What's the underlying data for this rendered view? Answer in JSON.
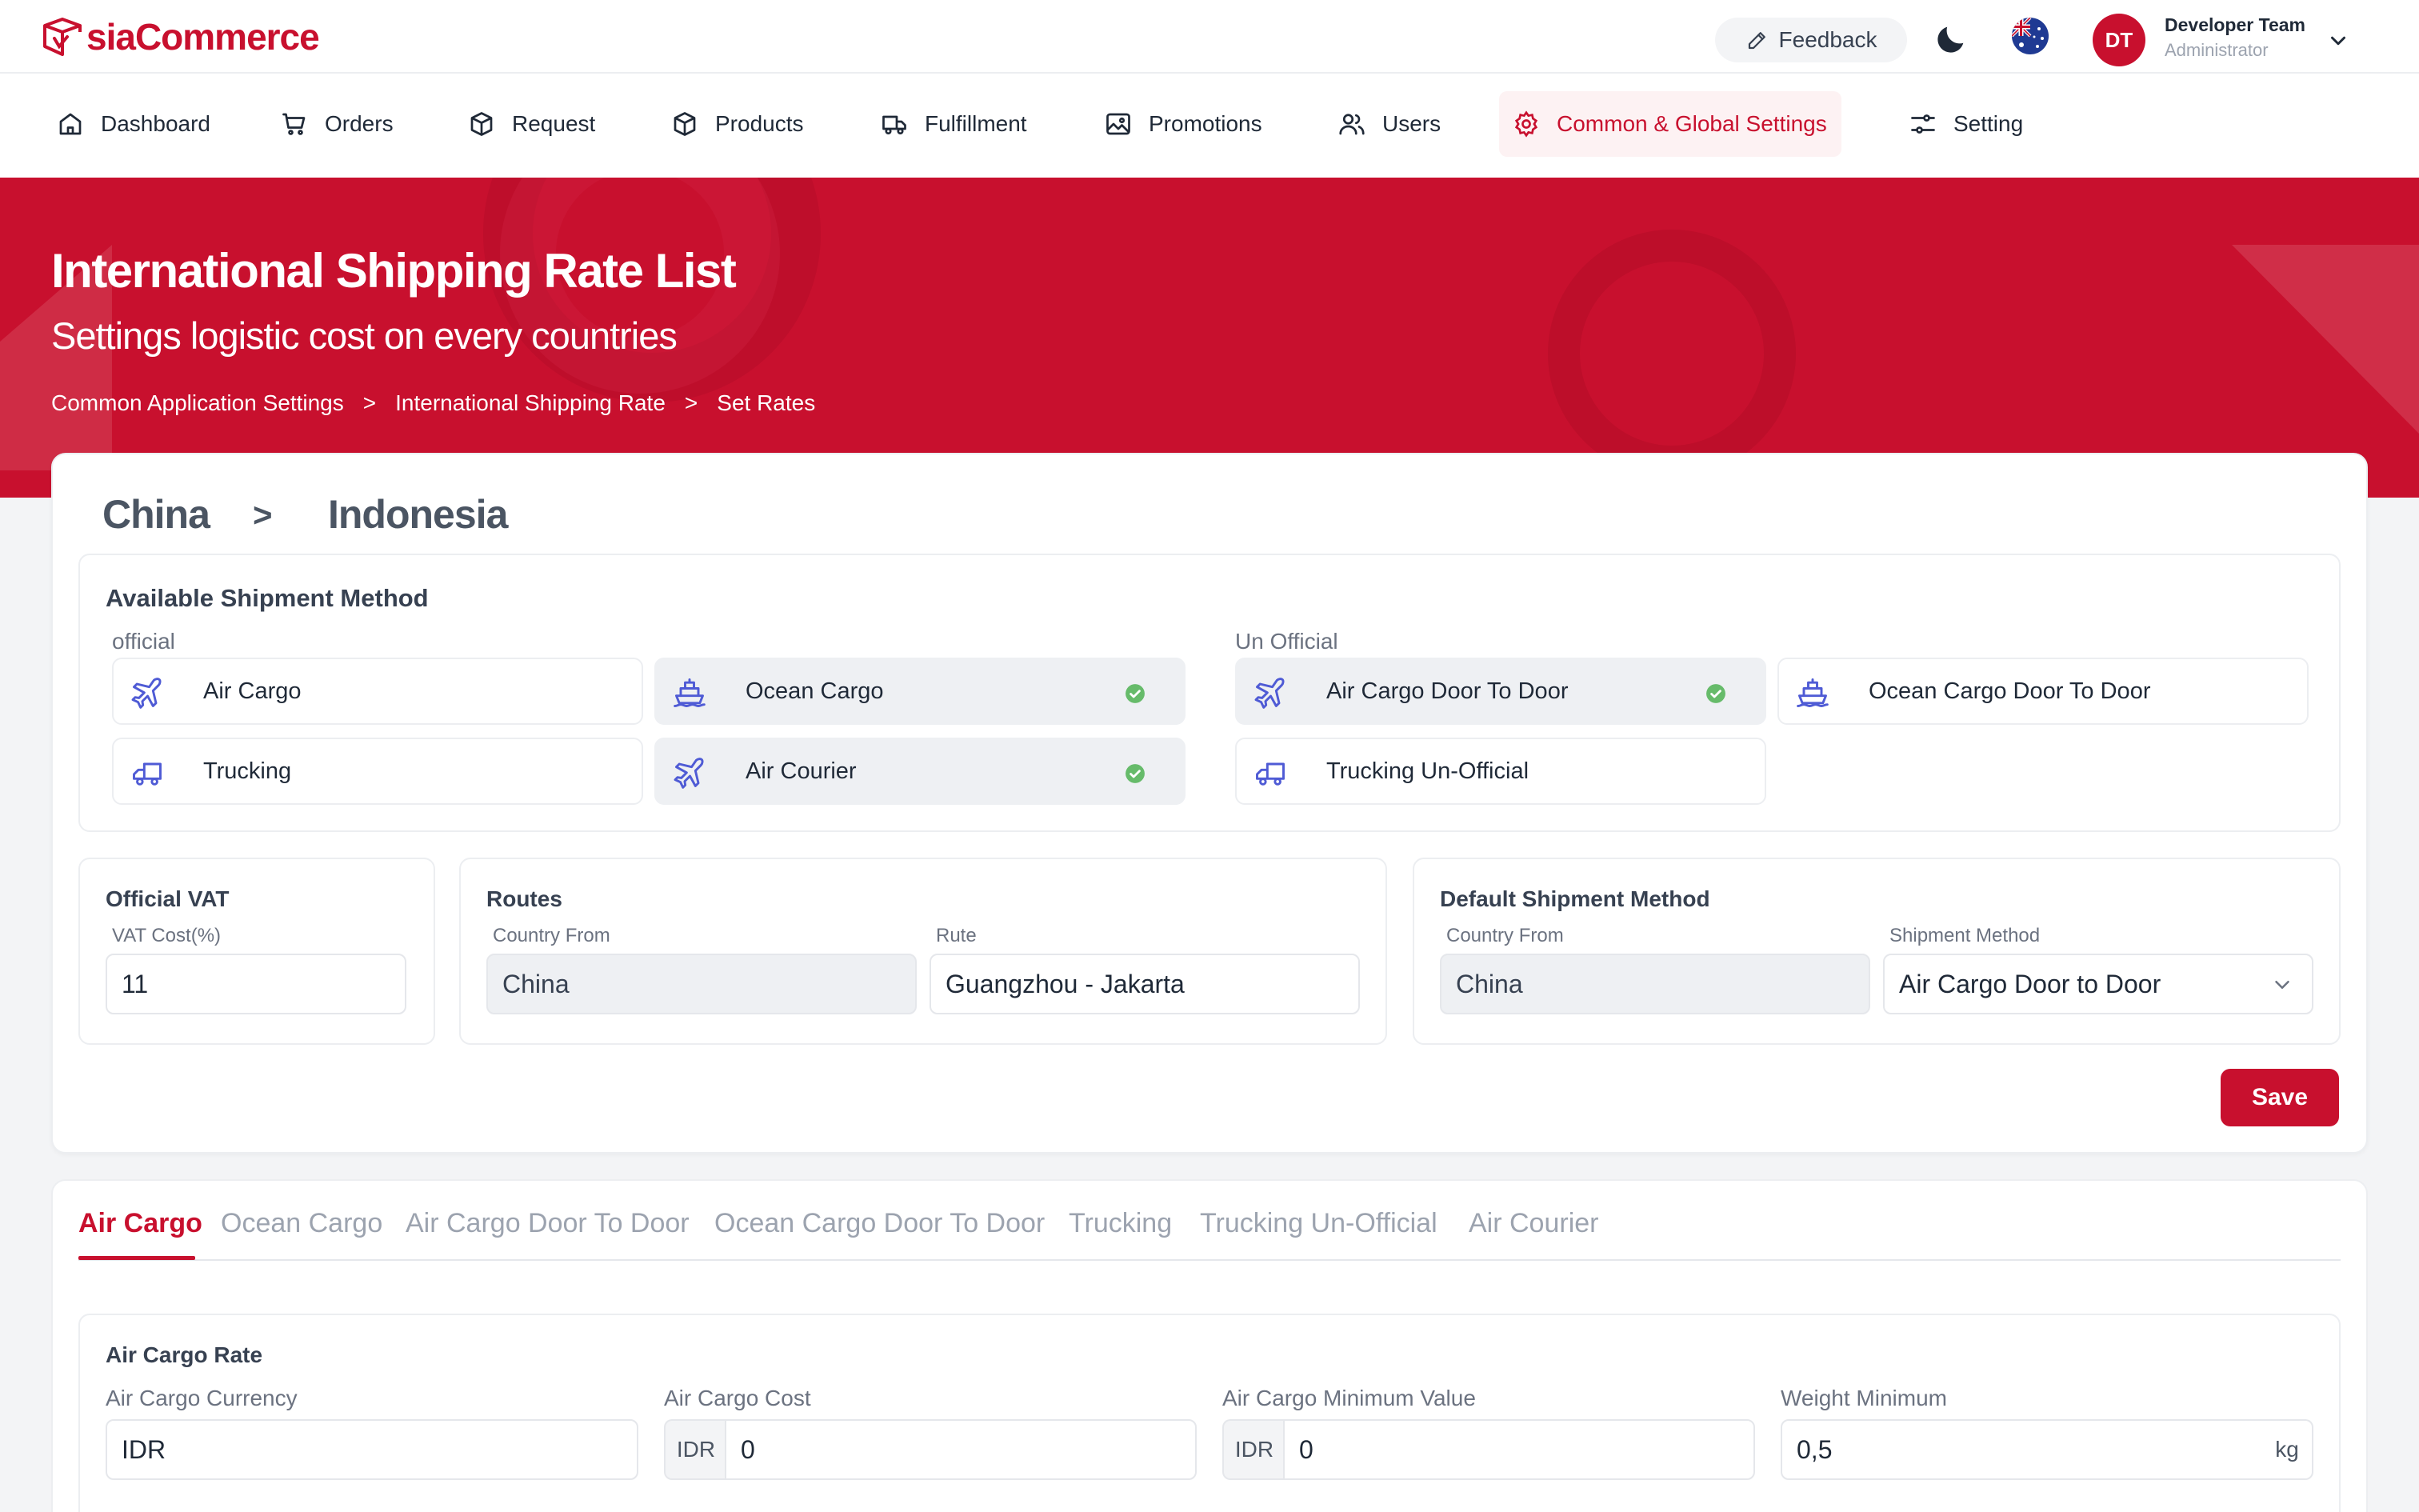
{
  "app": {
    "logo_text": "siaCommerce",
    "brand_color": "#c8102e"
  },
  "header": {
    "feedback_label": "Feedback",
    "user": {
      "initials": "DT",
      "name": "Developer Team",
      "role": "Administrator"
    }
  },
  "nav": {
    "items": [
      {
        "label": "Dashboard",
        "icon": "home-icon"
      },
      {
        "label": "Orders",
        "icon": "cart-icon"
      },
      {
        "label": "Request",
        "icon": "box-icon"
      },
      {
        "label": "Products",
        "icon": "box-icon"
      },
      {
        "label": "Fulfillment",
        "icon": "truck-icon"
      },
      {
        "label": "Promotions",
        "icon": "image-icon"
      },
      {
        "label": "Users",
        "icon": "users-icon"
      },
      {
        "label": "Common & Global Settings",
        "icon": "gear-icon",
        "active": true
      },
      {
        "label": "Setting",
        "icon": "sliders-icon"
      }
    ]
  },
  "hero": {
    "title": "International Shipping Rate List",
    "subtitle": "Settings logistic cost on every countries",
    "breadcrumb": [
      "Common Application Settings",
      "International Shipping Rate",
      "Set Rates"
    ],
    "separator": ">"
  },
  "route": {
    "from": "China",
    "separator": ">",
    "to": "Indonesia"
  },
  "shipment_methods": {
    "title": "Available Shipment Method",
    "official_label": "official",
    "unofficial_label": "Un Official",
    "official": [
      {
        "label": "Air Cargo",
        "icon": "airplane-icon",
        "selected": false
      },
      {
        "label": "Ocean Cargo",
        "icon": "ship-icon",
        "selected": true
      },
      {
        "label": "Trucking",
        "icon": "truck-icon",
        "selected": false
      },
      {
        "label": "Air Courier",
        "icon": "airplane-icon",
        "selected": true
      }
    ],
    "unofficial": [
      {
        "label": "Air Cargo Door To Door",
        "icon": "airplane-icon",
        "selected": true
      },
      {
        "label": "Ocean Cargo Door To Door",
        "icon": "ship-icon",
        "selected": false
      },
      {
        "label": "Trucking Un-Official",
        "icon": "truck-icon",
        "selected": false
      }
    ]
  },
  "vat": {
    "title": "Official VAT",
    "label": "VAT Cost(%)",
    "value": "11"
  },
  "routes": {
    "title": "Routes",
    "country_from_label": "Country From",
    "country_from_value": "China",
    "rute_label": "Rute",
    "rute_value": "Guangzhou - Jakarta"
  },
  "default_method": {
    "title": "Default Shipment Method",
    "country_from_label": "Country From",
    "country_from_value": "China",
    "method_label": "Shipment Method",
    "method_value": "Air Cargo Door to Door"
  },
  "save_label": "Save",
  "tabs": [
    {
      "label": "Air Cargo",
      "active": true
    },
    {
      "label": "Ocean Cargo"
    },
    {
      "label": "Air Cargo Door To Door"
    },
    {
      "label": "Ocean Cargo Door To Door"
    },
    {
      "label": "Trucking"
    },
    {
      "label": "Trucking Un-Official"
    },
    {
      "label": "Air Courier"
    }
  ],
  "air_cargo_rate": {
    "title": "Air Cargo Rate",
    "currency_label": "Air Cargo Currency",
    "currency_value": "IDR",
    "cost_label": "Air Cargo Cost",
    "cost_prefix": "IDR",
    "cost_value": "0",
    "min_value_label": "Air Cargo Minimum Value",
    "min_value_prefix": "IDR",
    "min_value_value": "0",
    "weight_min_label": "Weight Minimum",
    "weight_min_value": "0,5",
    "weight_min_suffix": "kg"
  }
}
